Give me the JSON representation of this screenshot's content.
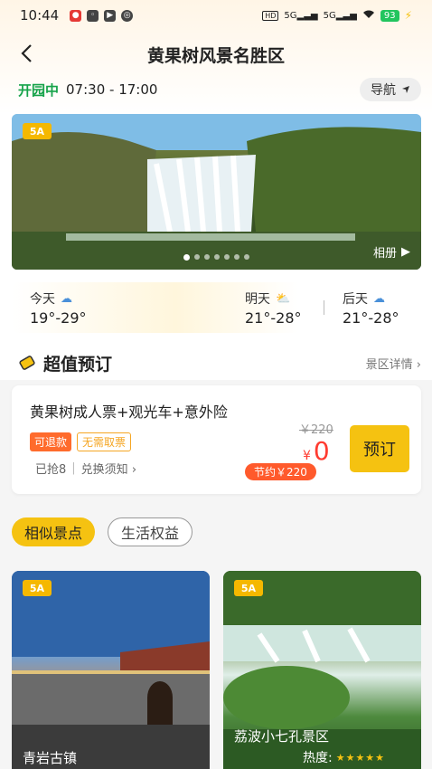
{
  "status_bar": {
    "time": "10:44",
    "network1": "5G",
    "network2": "5G",
    "battery": "93"
  },
  "header": {
    "title": "黄果树风景名胜区"
  },
  "open_info": {
    "status": "开园中",
    "hours": "07:30 - 17:00",
    "nav_label": "导航"
  },
  "banner": {
    "rating_tag": "5A",
    "album_label": "相册",
    "slide_count": 7,
    "active_slide": 1
  },
  "weather": {
    "days": [
      {
        "label": "今天",
        "temp": "19°-29°",
        "icon": "cloud-icon"
      },
      {
        "label": "明天",
        "temp": "21°-28°",
        "icon": "sun-cloud-icon"
      },
      {
        "label": "后天",
        "temp": "21°-28°",
        "icon": "cloud-icon"
      }
    ]
  },
  "booking_section": {
    "title": "超值预订",
    "detail_link": "景区详情"
  },
  "ticket": {
    "name": "黄果树成人票+观光车+意外险",
    "badge_refund": "可退款",
    "badge_noticket": "无需取票",
    "sold": "已抢8",
    "exchange_note": "兑换须知",
    "original_price": "￥220",
    "currency": "¥",
    "price": "0",
    "saving": "节约￥220",
    "book_label": "预订"
  },
  "tabs": {
    "similar": "相似景点",
    "perks": "生活权益"
  },
  "spots": [
    {
      "tag": "5A",
      "name": "青岩古镇"
    },
    {
      "tag": "5A",
      "name": "荔波小七孔景区",
      "heat_label": "热度:",
      "heat_stars": 5
    }
  ],
  "colors": {
    "accent": "#f5c211",
    "open_green": "#16a34a",
    "price_red": "#ff3b30"
  }
}
